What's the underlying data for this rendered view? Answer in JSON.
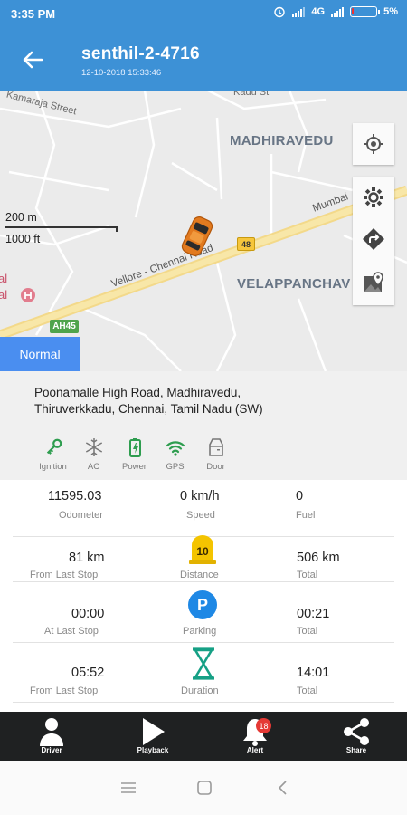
{
  "status_bar": {
    "time": "3:35 PM",
    "network": "4G",
    "battery": "5%",
    "battery_level": 0.05
  },
  "header": {
    "title": "senthil-2-4716",
    "subtitle": "12-10-2018 15:33:46"
  },
  "map": {
    "labels": {
      "madhiravedu": "MADHIRAVEDU",
      "velappanchavadi": "VELAPPANCHAV",
      "road": "Vellore - Chennai Road",
      "mumbai": "Mumbai",
      "kamaraja": "Kamaraja Street",
      "kadu": "Kadu St",
      "al": "al",
      "al2": "al",
      "route": "48",
      "ah": "AH45"
    },
    "scale": {
      "meters": "200 m",
      "feet": "1000 ft"
    },
    "mode_button": "Normal"
  },
  "address": "Poonamalle High Road, Madhiravedu, Thiruverkkadu, Chennai, Tamil Nadu (SW)",
  "indicators": [
    {
      "label": "Ignition",
      "icon": "key-icon",
      "color": "#2e9d4f"
    },
    {
      "label": "AC",
      "icon": "snowflake-icon",
      "color": "#777777"
    },
    {
      "label": "Power",
      "icon": "battery-icon",
      "color": "#2e9d4f"
    },
    {
      "label": "GPS",
      "icon": "wifi-icon",
      "color": "#2e9d4f"
    },
    {
      "label": "Door",
      "icon": "door-icon",
      "color": "#777777"
    }
  ],
  "stats": {
    "odometer": {
      "value": "11595.03",
      "label": "Odometer"
    },
    "speed": {
      "value": "0 km/h",
      "label": "Speed"
    },
    "fuel": {
      "value": "0",
      "label": "Fuel"
    },
    "last_stop_distance": {
      "value": "81 km",
      "label": "From Last Stop"
    },
    "distance": {
      "badge": "10",
      "label": "Distance"
    },
    "total_distance": {
      "value": "506 km",
      "label": "Total"
    },
    "at_last_stop": {
      "value": "00:00",
      "label": "At Last Stop"
    },
    "parking": {
      "badge": "P",
      "label": "Parking"
    },
    "total_parking": {
      "value": "00:21",
      "label": "Total"
    },
    "from_last_stop_time": {
      "value": "05:52",
      "label": "From Last Stop"
    },
    "duration": {
      "label": "Duration"
    },
    "total_duration": {
      "value": "14:01",
      "label": "Total"
    }
  },
  "bottom_nav": [
    {
      "label": "Driver"
    },
    {
      "label": "Playback"
    },
    {
      "label": "Alert",
      "badge": "18"
    },
    {
      "label": "Share"
    }
  ],
  "colors": {
    "primary": "#3d91d6",
    "accent_green": "#2e9d4f",
    "parking_blue": "#1e88e5",
    "distance_yellow": "#f4c400",
    "duration_teal": "#16a085",
    "nav_dark": "#1f2122"
  }
}
